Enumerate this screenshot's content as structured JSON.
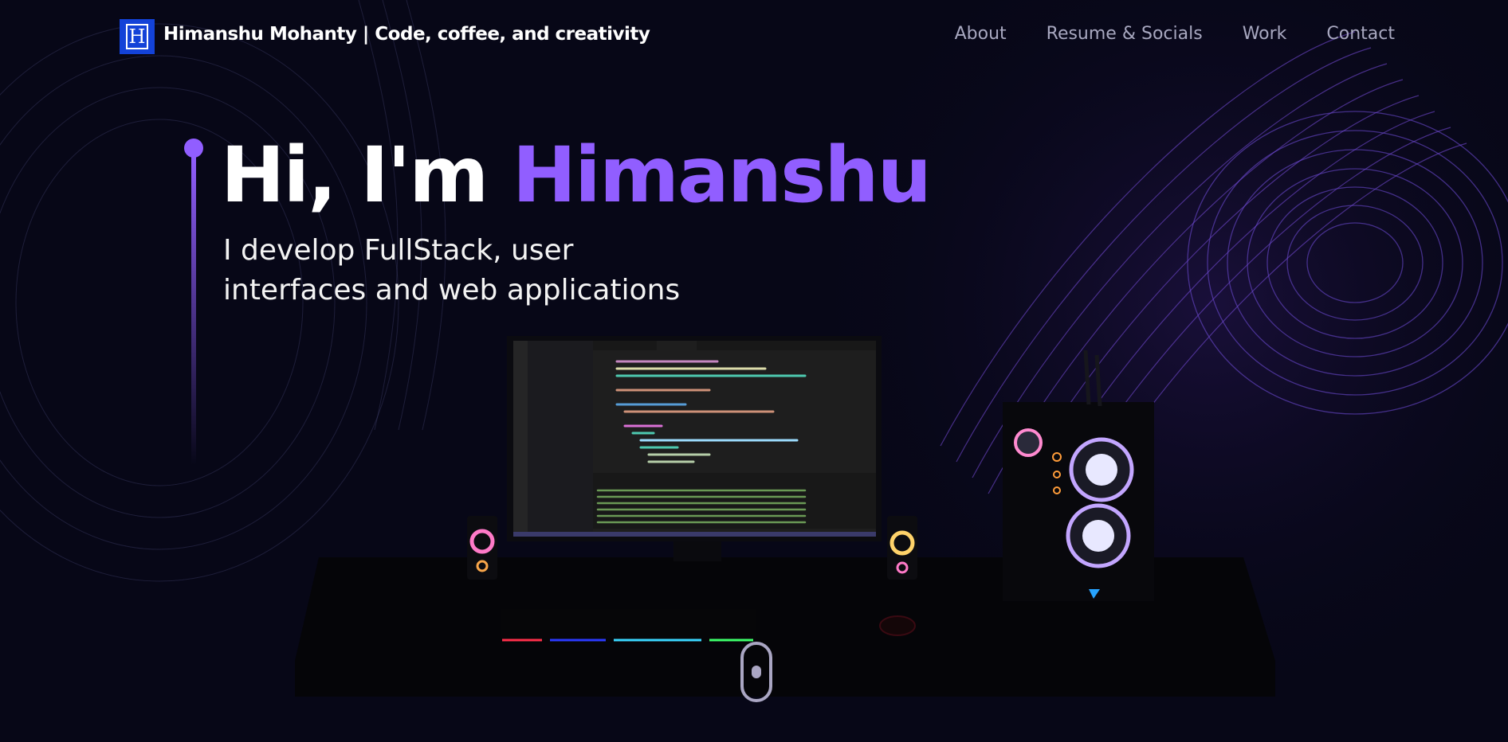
{
  "nav": {
    "logo_letter": "H",
    "brand": "Himanshu Mohanty | Code, coffee, and creativity",
    "links": [
      "About",
      "Resume & Socials",
      "Work",
      "Contact"
    ]
  },
  "hero": {
    "greeting": "Hi, I'm ",
    "name": "Himanshu",
    "subtitle_line1": "I develop FullStack, user",
    "subtitle_line2": "interfaces and web applications"
  },
  "colors": {
    "background": "#070717",
    "accent": "#915eff",
    "logo_bg": "#1342d8",
    "nav_text": "#a8a8c0"
  },
  "icons": {
    "scroll": "mouse-scroll-icon"
  }
}
